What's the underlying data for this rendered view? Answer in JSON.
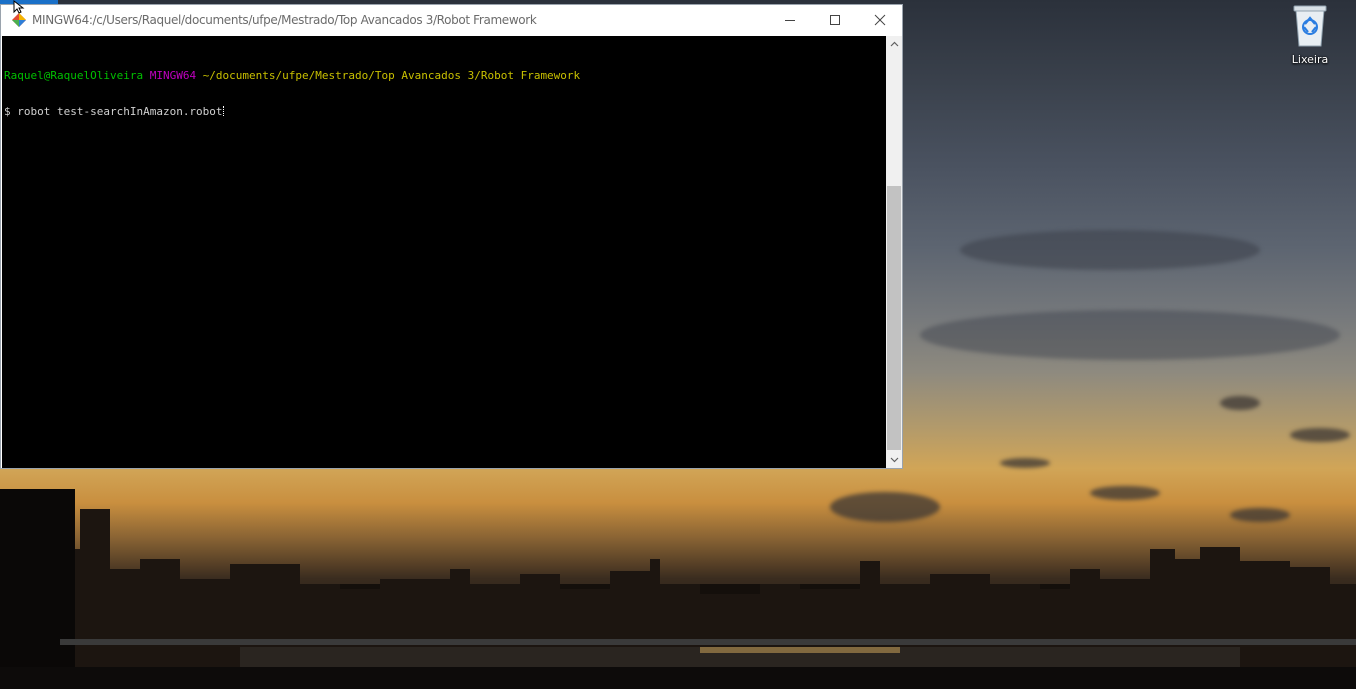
{
  "window": {
    "title": "MINGW64:/c/Users/Raquel/documents/ufpe/Mestrado/Top Avancados 3/Robot Framework",
    "icon": "git-bash-icon",
    "buttons": [
      "minimize-icon",
      "maximize-icon",
      "close-icon"
    ]
  },
  "terminal": {
    "prompt_user": "Raquel@RaquelOliveira",
    "prompt_env": "MINGW64",
    "prompt_path": "~/documents/ufpe/Mestrado/Top Avancados 3/Robot Framework",
    "command_prefix": "$ ",
    "command": "robot test-searchInAmazon.robot"
  },
  "desktop": {
    "recycle_bin_label": "Lixeira",
    "recycle_bin_icon": "recycle-bin-icon"
  },
  "colors": {
    "prompt_user": "#00c000",
    "prompt_env": "#c000c0",
    "prompt_path": "#c8c000",
    "terminal_bg": "#000000"
  }
}
